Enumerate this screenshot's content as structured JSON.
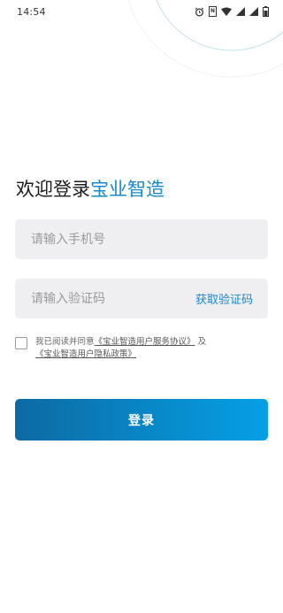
{
  "status_bar": {
    "time": "14:54",
    "icons": [
      "alarm-icon",
      "nfc-icon",
      "wifi-icon",
      "signal-icon",
      "signal-4g-icon",
      "battery-icon"
    ],
    "nfc_label": "N"
  },
  "welcome": {
    "prefix": "欢迎登录",
    "brand": "宝业智造"
  },
  "phone_field": {
    "placeholder": "请输入手机号",
    "value": ""
  },
  "code_field": {
    "placeholder": "请输入验证码",
    "value": "",
    "get_code_label": "获取验证码"
  },
  "agreement": {
    "checked": false,
    "prefix": "我已阅读并同意",
    "service_link": "《宝业智造用户服务协议》",
    "joiner": "及",
    "privacy_link": "《宝业智造用户隐私政策》"
  },
  "login_button": {
    "label": "登录"
  },
  "colors": {
    "brand": "#1a88c9",
    "button_start": "#0d6aa3",
    "button_end": "#05a0e6",
    "field_bg": "#efeff1"
  }
}
